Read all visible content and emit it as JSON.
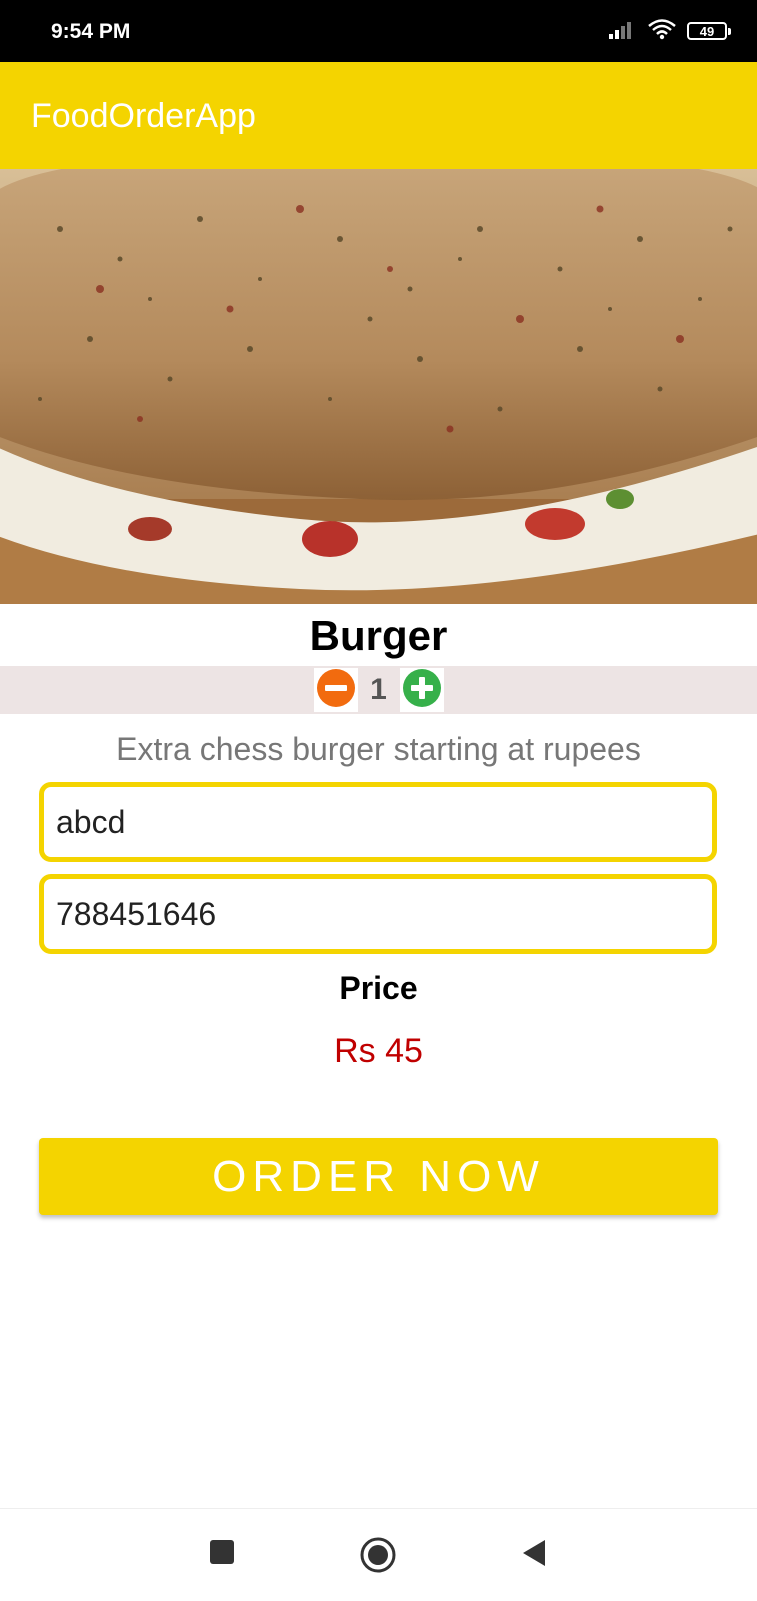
{
  "status_bar": {
    "time": "9:54 PM",
    "battery": "49"
  },
  "app_bar": {
    "title": "FoodOrderApp"
  },
  "product": {
    "name": "Burger",
    "quantity": "1",
    "description": "Extra chess burger starting at rupees"
  },
  "form": {
    "name_value": "abcd",
    "phone_value": "788451646"
  },
  "price": {
    "label": "Price",
    "value": "Rs 45"
  },
  "order_button": {
    "label": "ORDER NOW"
  },
  "colors": {
    "accent": "#f4d400",
    "price": "#c00000",
    "minus": "#f26b0f",
    "plus": "#36b04a"
  },
  "icons": [
    "signal-icon",
    "wifi-icon",
    "battery-icon",
    "minus-icon",
    "plus-icon",
    "nav-recents-icon",
    "nav-home-icon",
    "nav-back-icon"
  ]
}
